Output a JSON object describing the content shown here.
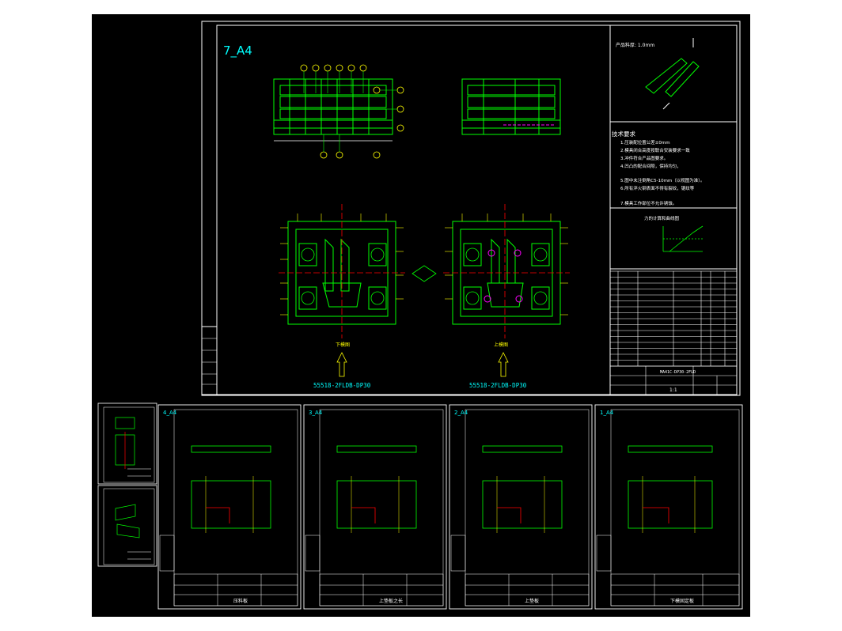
{
  "main_sheet": {
    "sheet_id": "7_A4",
    "product_thickness": "产品料厚: 1.0mm",
    "tech_heading": "技术要求",
    "tech_items": [
      "1.压装配位置公差±0mm",
      "2.模具闭合高度按联合安装要求一致",
      "3.冲件符合产品图要求。",
      "4.凹凸的配合间隙，保持均匀，",
      "5.图中未注倒角C5-10mm（以视图为准）。",
      "6.所有淬火钢表面不得有裂纹，锯纹等",
      "7.模具工作部位不允许锈蚀。"
    ],
    "force_curve_label": "力的计算和曲线图",
    "lower_view_label": "下模图",
    "upper_view_label": "上模图",
    "lower_part_no": "55518-2FLDB-DP30",
    "upper_part_no": "55518-2FLDB-DP30",
    "title_block_no": "MA41C-DP30-2FLD",
    "scale_label": "1:1",
    "bom_rows": 16
  },
  "sub_sheets": [
    {
      "id": "4_A4",
      "title": "压料板"
    },
    {
      "id": "3_A4",
      "title": "上垫板之长"
    },
    {
      "id": "2_A4",
      "title": "上垫板"
    },
    {
      "id": "1_A4",
      "title": "下模固定板"
    }
  ],
  "colors": {
    "background": "#000000",
    "frame": "#ffffff",
    "geometry": "#00ff00",
    "dims": "#ffff00",
    "centerline": "#ff0000",
    "accent_cyan": "#00ffff",
    "accent_magenta": "#ff00ff"
  }
}
